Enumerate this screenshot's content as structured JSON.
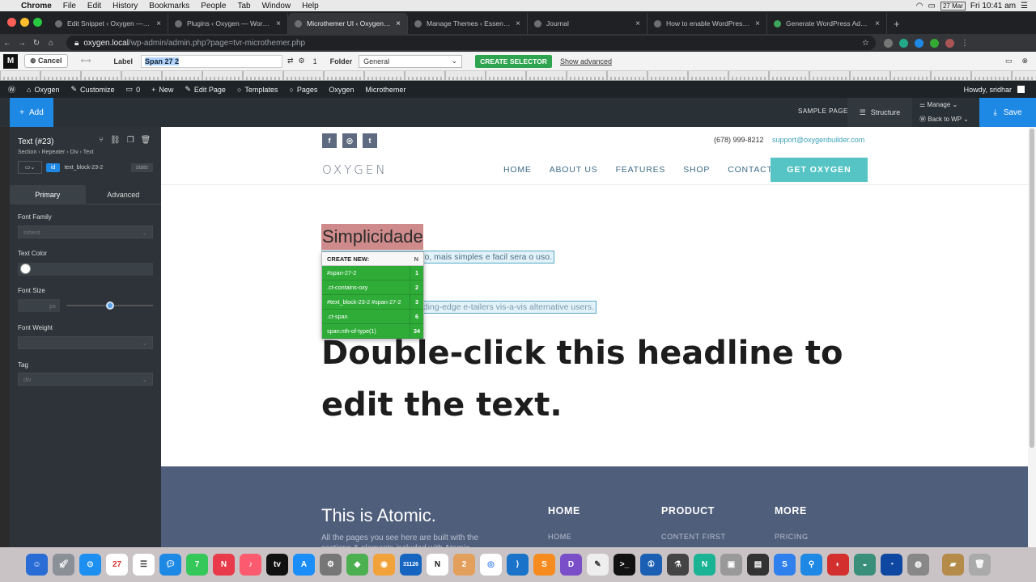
{
  "menubar": {
    "app": "Chrome",
    "items": [
      "File",
      "Edit",
      "History",
      "Bookmarks",
      "People",
      "Tab",
      "Window",
      "Help"
    ],
    "date": "27 Mar",
    "time": "Fri 10:41 am"
  },
  "tabs": [
    {
      "label": "Edit Snippet ‹ Oxygen — WordPress"
    },
    {
      "label": "Plugins ‹ Oxygen — WordPress"
    },
    {
      "label": "Microthemer UI ‹ Oxygen — WordPress"
    },
    {
      "label": "Manage Themes ‹ Essence Pro"
    },
    {
      "label": "Journal"
    },
    {
      "label": "How to enable WordPress Toolbar"
    },
    {
      "label": "Generate WordPress Admin Bar"
    }
  ],
  "address": {
    "host": "oxygen.local",
    "path": "/wp-admin/admin.php?page=tvr-microthemer.php"
  },
  "microthemer": {
    "logo": "M",
    "cancel": "Cancel",
    "label_caption": "Label",
    "label_value": "Span 27 2",
    "count": "1",
    "folder_caption": "Folder",
    "folder_value": "General",
    "create_selector": "CREATE SELECTOR",
    "show_advanced": "Show advanced"
  },
  "wpbar": {
    "site": "Oxygen",
    "customize": "Customize",
    "comments": "0",
    "new": "New",
    "edit_page": "Edit Page",
    "templates": "Templates",
    "pages": "Pages",
    "oxygen": "Oxygen",
    "microthemer": "Microthemer",
    "howdy": "Howdy, sridhar"
  },
  "oxybar": {
    "add": "Add",
    "sample_page": "SAMPLE PAGE",
    "structure": "Structure",
    "manage": "Manage",
    "back_to_wp": "Back to WP",
    "save": "Save"
  },
  "sidebar": {
    "heading": "Text (#23)",
    "breadcrumb": "Section › Repeater › Div › Text",
    "id_badge": "id",
    "id_value": "text_block-23-2",
    "state": "state",
    "tab_primary": "Primary",
    "tab_advanced": "Advanced",
    "font_family_label": "Font Family",
    "font_family_value": "Inherit",
    "text_color_label": "Text Color",
    "font_size_label": "Font Size",
    "font_size_unit": "px",
    "font_weight_label": "Font Weight",
    "tag_label": "Tag",
    "tag_value": "div"
  },
  "page": {
    "phone": "(678) 999-8212",
    "email": "support@oxygenbuilder.com",
    "logo": "OXYGEN",
    "nav": [
      "HOME",
      "ABOUT US",
      "FEATURES",
      "SHOP",
      "CONTACT"
    ],
    "cta": "GET OXYGEN",
    "simplicidade": "Simplicidade",
    "para1": "vo, mais simples e facil sera o uso.",
    "para2": "ading-edge e-tailers vis-a-vis alternative users.",
    "headline": "Double-click this headline to edit the text."
  },
  "popup": {
    "header": "CREATE NEW:",
    "header_n": "N",
    "rows": [
      {
        "sel": "#span-27-2",
        "n": "1"
      },
      {
        "sel": ".ct-contains-oxy",
        "n": "2"
      },
      {
        "sel": "#text_block-23-2 #span-27-2",
        "n": "3"
      },
      {
        "sel": ".ct-span",
        "n": "6"
      },
      {
        "sel": "span:nth-of-type(1)",
        "n": "34"
      }
    ]
  },
  "footer": {
    "title": "This is Atomic.",
    "desc": "All the pages you see here are built with the sections & elements included with Atomic.",
    "col1": "HOME",
    "col1_sub": "HOME",
    "col2": "PRODUCT",
    "col2_sub": "CONTENT FIRST",
    "col3": "MORE",
    "col3_sub": "PRICING"
  },
  "dock": {
    "calendar_day": "27",
    "badge_messages": "7",
    "badge_mail": "31126",
    "badge_app": "2"
  },
  "colors": {
    "accent_blue": "#1e88e5",
    "teal_cta": "#56c4c5",
    "popup_green": "#2fac38",
    "footer_bg": "#4f5e7b",
    "selection_red": "#cf8b8b"
  }
}
